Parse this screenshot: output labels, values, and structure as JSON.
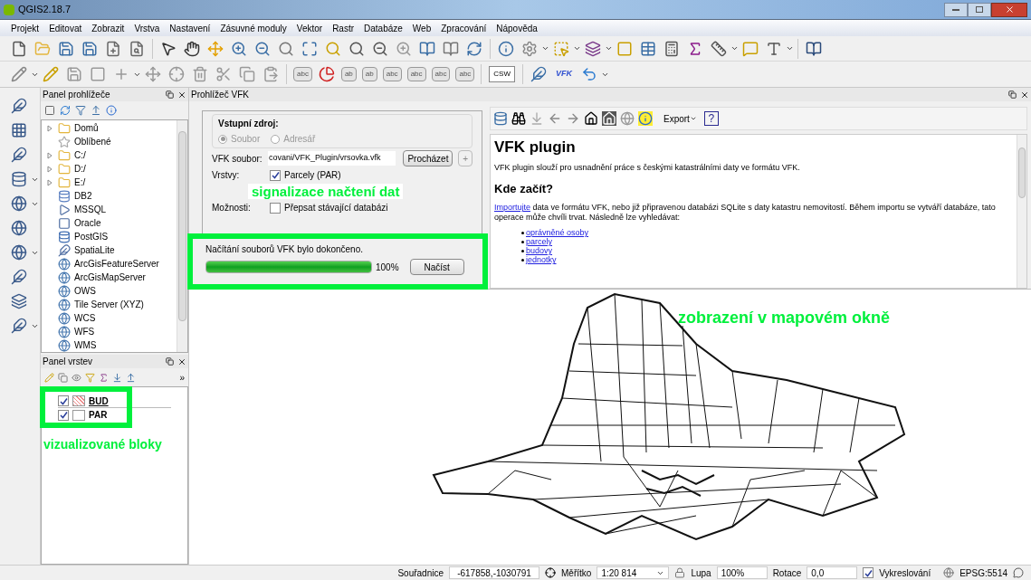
{
  "window": {
    "title": "QGIS2.18.7"
  },
  "menu": [
    "Projekt",
    "Editovat",
    "Zobrazit",
    "Vrstva",
    "Nastavení",
    "Zásuvné moduly",
    "Vektor",
    "Rastr",
    "Databáze",
    "Web",
    "Zpracování",
    "Nápověda"
  ],
  "toolbar_2": {
    "label_icons": [
      "abc",
      "ab",
      "ab",
      "abc",
      "abc",
      "abc",
      "abc"
    ],
    "csw": "CSW",
    "vfk": "VFK"
  },
  "browser_panel": {
    "title": "Panel prohlížeče",
    "items": [
      {
        "label": "Domů",
        "kind": "folder",
        "expandable": true
      },
      {
        "label": "Oblíbené",
        "kind": "favorites",
        "expandable": false
      },
      {
        "label": "C:/",
        "kind": "folder",
        "expandable": true
      },
      {
        "label": "D:/",
        "kind": "folder",
        "expandable": true
      },
      {
        "label": "E:/",
        "kind": "folder",
        "expandable": true
      },
      {
        "label": "DB2",
        "kind": "db2",
        "expandable": false
      },
      {
        "label": "MSSQL",
        "kind": "mssql",
        "expandable": false
      },
      {
        "label": "Oracle",
        "kind": "oracle",
        "expandable": false
      },
      {
        "label": "PostGIS",
        "kind": "postgis",
        "expandable": false
      },
      {
        "label": "SpatiaLite",
        "kind": "spatialite",
        "expandable": false
      },
      {
        "label": "ArcGisFeatureServer",
        "kind": "globe",
        "expandable": false
      },
      {
        "label": "ArcGisMapServer",
        "kind": "globe",
        "expandable": false
      },
      {
        "label": "OWS",
        "kind": "globe",
        "expandable": false
      },
      {
        "label": "Tile Server (XYZ)",
        "kind": "globe",
        "expandable": false
      },
      {
        "label": "WCS",
        "kind": "globe",
        "expandable": false
      },
      {
        "label": "WFS",
        "kind": "globe",
        "expandable": false
      },
      {
        "label": "WMS",
        "kind": "globe",
        "expandable": false
      }
    ]
  },
  "layers_panel": {
    "title": "Panel vrstev",
    "more": "»",
    "layers": [
      {
        "name": "BUD",
        "checked": true,
        "selected": true,
        "kind": "hatched"
      },
      {
        "name": "PAR",
        "checked": true,
        "selected": false,
        "kind": "blank"
      }
    ]
  },
  "vfk_panel": {
    "title": "Prohlížeč VFK",
    "source_group": "Vstupní zdroj:",
    "source_options": [
      {
        "label": "Soubor",
        "selected": true,
        "disabled": true
      },
      {
        "label": "Adresář",
        "selected": false,
        "disabled": true
      }
    ],
    "file_label": "VFK soubor:",
    "file_value": "covani/VFK_Plugin/vrsovka.vfk",
    "browse_button": "Procházet",
    "add_button": "+",
    "layers_label": "Vrstvy:",
    "layer_options": [
      {
        "label": "Parcely (PAR)",
        "checked": true
      }
    ],
    "options_label": "Možnosti:",
    "options": [
      {
        "label": "Přepsat stávající databázi",
        "checked": false
      }
    ],
    "status": "Načítání souborů VFK bylo dokončeno.",
    "progress": {
      "level": 1.0,
      "reading": "100%"
    },
    "load_button": "Načíst"
  },
  "help": {
    "export_button": "Export",
    "help_button": "?",
    "title": "VFK plugin",
    "intro": "VFK plugin slouží pro usnadnění práce s českými katastrálními daty ve formátu VFK.",
    "heading": "Kde začít?",
    "link": "Importujte",
    "paragraph": "data ve formátu VFK, nebo již připravenou databázi SQLite s daty katastru nemovitostí. Během importu se vytváří databáze, tato operace může chvíli trvat. Následně lze vyhledávat:",
    "links": [
      "oprávněné osoby",
      "parcely",
      "budovy",
      "jednotky"
    ]
  },
  "annotations": {
    "progress_label": "signalizace načtení dat",
    "map_label": "zobrazení v mapovém okně",
    "layers_label": "vizualizované bloky"
  },
  "status_bar": {
    "coords_label": "Souřadnice",
    "coords": "-617858,-1030791",
    "scale_label": "Měřítko",
    "scale": "1:20 814",
    "zoom_label": "Lupa",
    "zoom": "100%",
    "rotation_label": "Rotace",
    "rotation": "0,0",
    "render_label": "Vykreslování",
    "render_checked": true,
    "crs": "EPSG:5514"
  }
}
